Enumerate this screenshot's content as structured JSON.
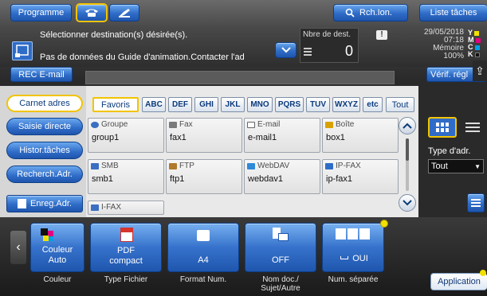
{
  "top": {
    "programme": "Programme",
    "search": "Rch.Ion.",
    "jobs": "Liste tâches"
  },
  "message": {
    "line1": "Sélectionner destination(s) désirée(s).",
    "line2": "Pas de données du Guide d'animation.Contacter l'ad",
    "dest_label": "Nbre de dest.",
    "dest_count": "0",
    "date": "29/05/2018",
    "time": "07:18",
    "memory_label": "Mémoire",
    "memory_value": "100%",
    "toner": [
      "Y",
      "M",
      "C",
      "K"
    ]
  },
  "rec_email": "REC E-mail",
  "verify": "Vérif. régl",
  "left_tabs": [
    "Carnet adres",
    "Saisie directe",
    "Histor.tâches",
    "Recherch.Adr."
  ],
  "enreg": "Enreg.Adr.",
  "index": [
    "Favoris",
    "ABC",
    "DEF",
    "GHI",
    "JKL",
    "MNO",
    "PQRS",
    "TUV",
    "WXYZ",
    "etc",
    "Tout"
  ],
  "cards": [
    {
      "type": "Groupe",
      "name": "group1"
    },
    {
      "type": "Fax",
      "name": "fax1"
    },
    {
      "type": "E-mail",
      "name": "e-mail1"
    },
    {
      "type": "Boîte",
      "name": "box1"
    },
    {
      "type": "SMB",
      "name": "smb1"
    },
    {
      "type": "FTP",
      "name": "ftp1"
    },
    {
      "type": "WebDAV",
      "name": "webdav1"
    },
    {
      "type": "IP-FAX",
      "name": "ip-fax1"
    },
    {
      "type": "I-FAX",
      "name": ""
    }
  ],
  "addr_type": {
    "label": "Type d'adr.",
    "value": "Tout"
  },
  "bottom": [
    {
      "value": "Couleur\nAuto",
      "label": "Couleur"
    },
    {
      "value": "PDF\ncompact",
      "label": "Type Fichier"
    },
    {
      "value": "A4",
      "label": "Format Num."
    },
    {
      "value": "OFF",
      "label": "Nom doc./\nSujet/Autre"
    },
    {
      "value": "OUI",
      "label": "Num. séparée"
    }
  ],
  "application": "Application",
  "colors": {
    "accent": "#2f6cc7",
    "highlight": "#f2c400",
    "bar": "#5b5b5b"
  }
}
